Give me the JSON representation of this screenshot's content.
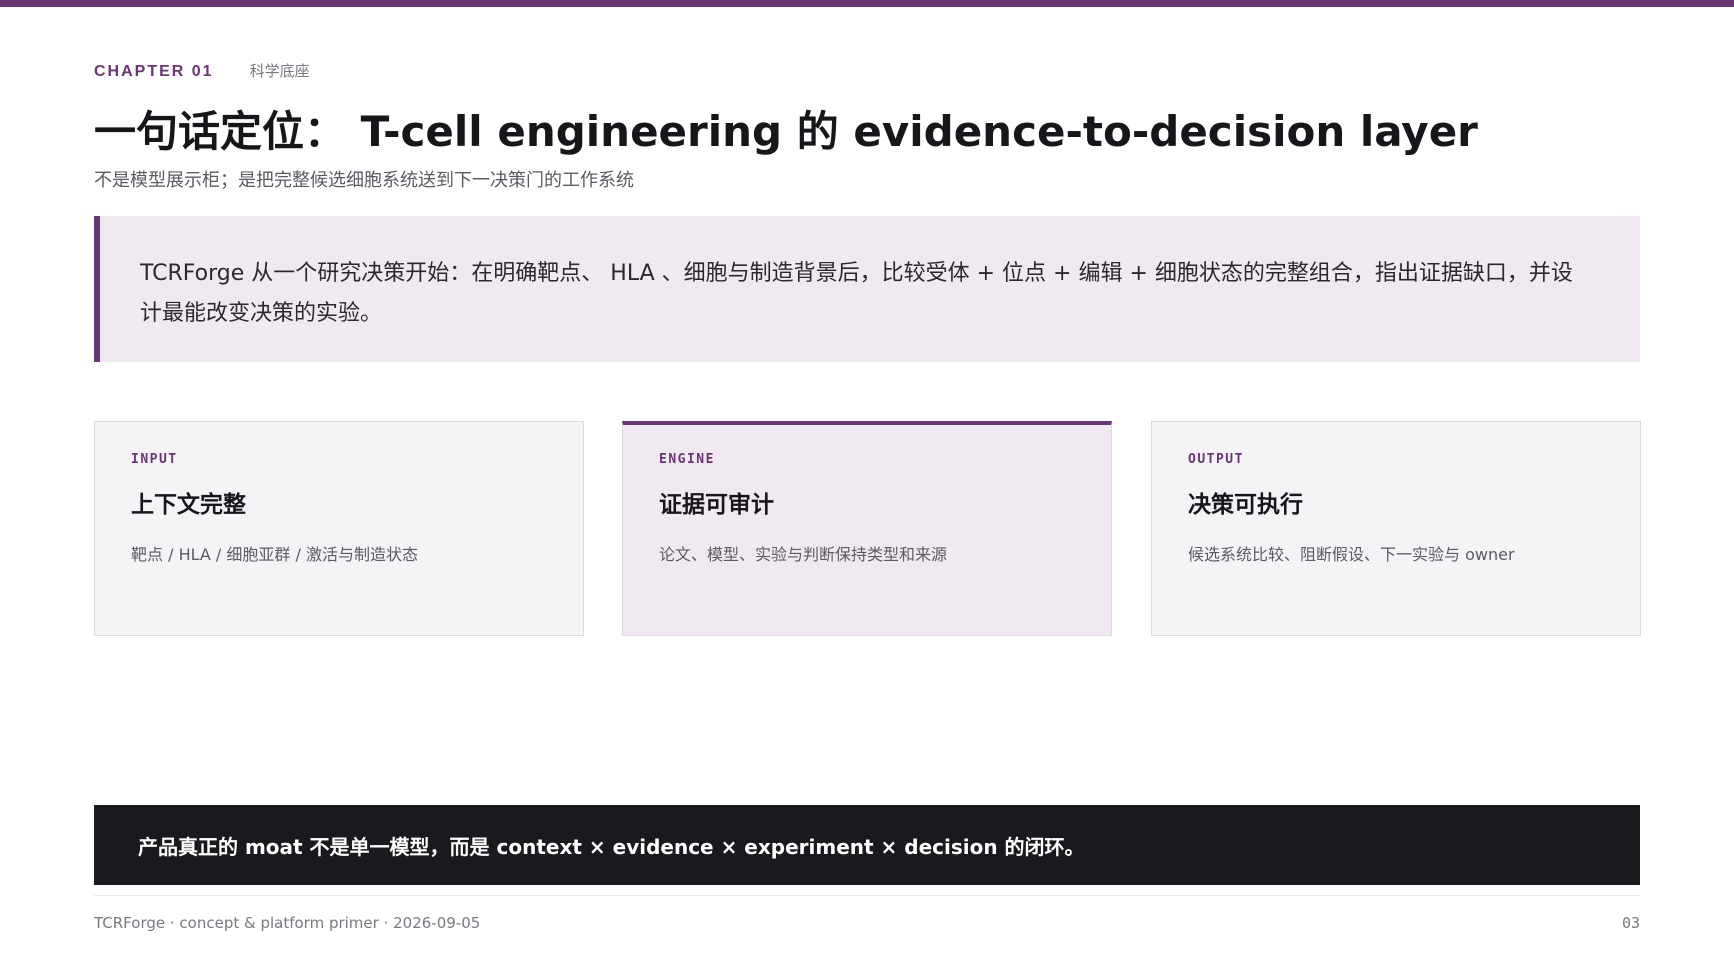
{
  "header": {
    "chapter_label": "CHAPTER 01",
    "chapter_sub": "科学底座",
    "title": "一句话定位： T-cell engineering  的  evidence-to-decision layer",
    "subtitle": "不是模型展示柜；是把完整候选细胞系统送到下一决策门的工作系统"
  },
  "callout": {
    "text": "TCRForge  从一个研究决策开始：在明确靶点、 HLA 、细胞与制造背景后，比较受体  +  位点  +  编辑  +  细胞状态的完整组合，指出证据缺口，并设计最能改变决策的实验。"
  },
  "cards": [
    {
      "tag": "INPUT",
      "title": "上下文完整",
      "desc": "靶点  / HLA /  细胞亚群  /  激活与制造状态"
    },
    {
      "tag": "ENGINE",
      "title": "证据可审计",
      "desc": "论文、模型、实验与判断保持类型和来源"
    },
    {
      "tag": "OUTPUT",
      "title": "决策可执行",
      "desc": "候选系统比较、阻断假设、下一实验与  owner"
    }
  ],
  "moat": {
    "text": "产品真正的  moat  不是单一模型，而是  context × evidence × experiment × decision  的闭环。"
  },
  "footer": {
    "left": "TCRForge · concept & platform primer · 2026-09-05",
    "page": "03"
  },
  "colors": {
    "accent": "#6a3574",
    "callout_bg": "#f1e9f1",
    "dark_bar": "#1a191d"
  }
}
